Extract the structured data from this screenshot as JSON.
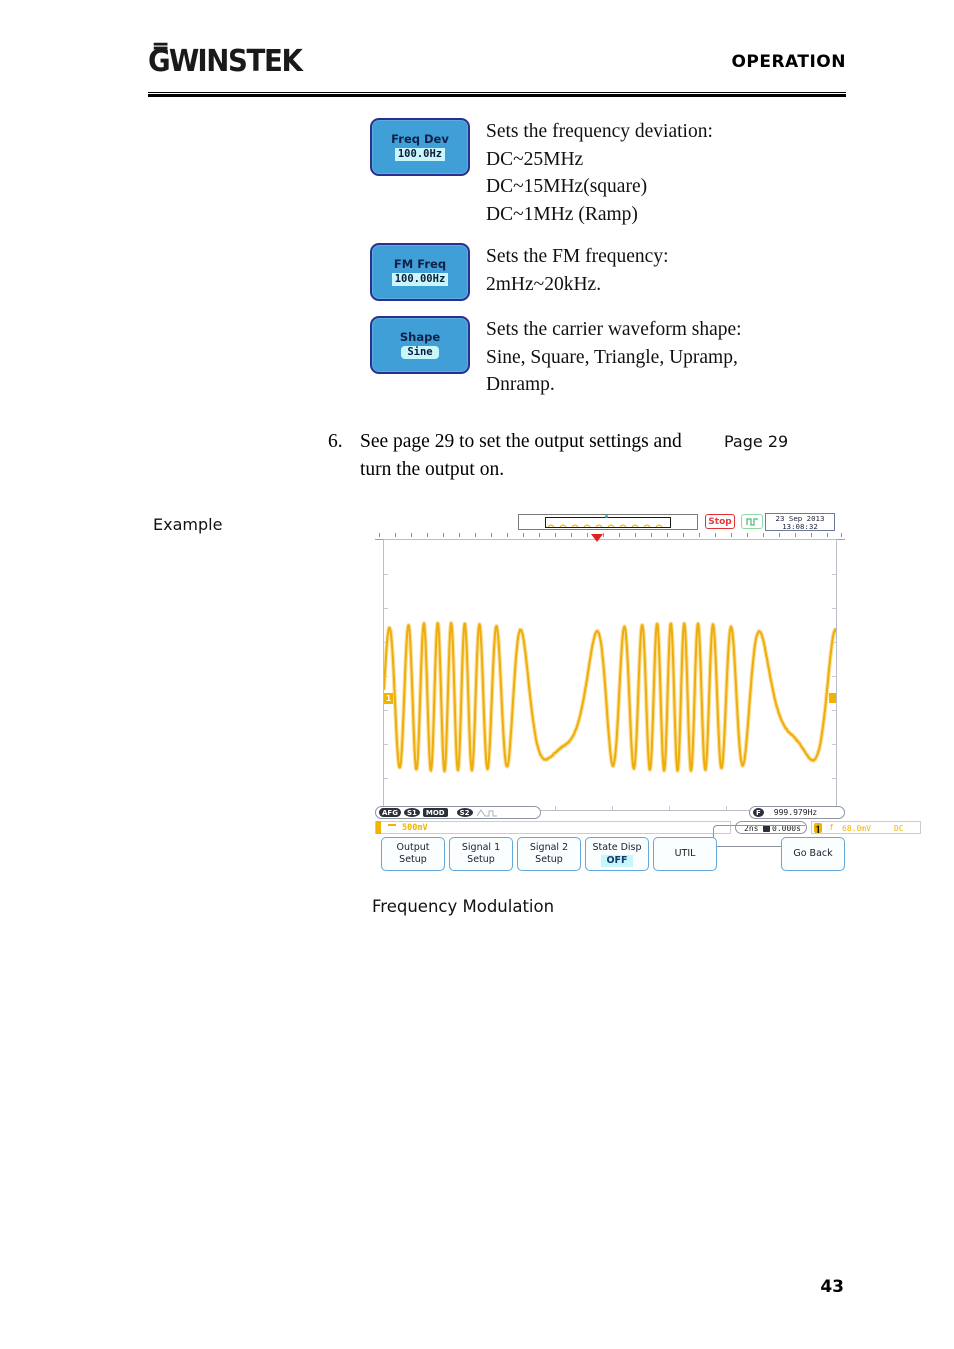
{
  "header": {
    "logo_gw": "G̿W",
    "logo_instek": "INSTEK",
    "title": "OPERATION"
  },
  "parameters": [
    {
      "key_label": "Freq Dev",
      "key_value": "100.0Hz",
      "description": "Sets the frequency deviation:\nDC~25MHz\nDC~15MHz(square)\nDC~1MHz (Ramp)"
    },
    {
      "key_label": "FM Freq",
      "key_value": "100.00Hz",
      "description": "Sets the FM frequency:\n2mHz~20kHz."
    },
    {
      "key_label": "Shape",
      "key_value": "Sine",
      "description": "Sets the carrier waveform shape:\nSine, Square, Triangle, Upramp,\nDnramp."
    }
  ],
  "step": {
    "number": "6.",
    "text": "See page 29 to set the output settings and turn the output on.",
    "xref": "Page 29"
  },
  "example": {
    "label": "Example",
    "caption": "Frequency Modulation"
  },
  "scope": {
    "status": "Stop",
    "date": "23 Sep 2013",
    "time": "13:08:32",
    "badges": [
      "AFG",
      "S1",
      "MOD",
      "S2"
    ],
    "frequency": "999.979Hz",
    "frequency_badge": "F",
    "channel1": {
      "label": "1",
      "volts_div": "500mV"
    },
    "timebase": "2ns",
    "horizontal_offset": "0.000s",
    "trigger": {
      "source": "1",
      "slope": "f",
      "level": "68.0mV",
      "coupling": "DC"
    },
    "softkeys": [
      {
        "line1": "Output",
        "line2": "Setup",
        "value": ""
      },
      {
        "line1": "Signal 1",
        "line2": "Setup",
        "value": ""
      },
      {
        "line1": "Signal 2",
        "line2": "Setup",
        "value": ""
      },
      {
        "line1": "State Disp",
        "line2": "",
        "value": "OFF"
      },
      {
        "line1": "UTIL",
        "line2": "",
        "value": ""
      },
      {
        "line1": "Go Back",
        "line2": "",
        "value": ""
      }
    ],
    "colors": {
      "waveform": "#eead0e",
      "channel": "#f0b400",
      "stop": "#e23b3b",
      "trigger_marker": "#e32020",
      "key_face": "#3e9ed5",
      "key_border": "#2b2f8f",
      "value_highlight": "#c9f6fb"
    }
  },
  "page_number": "43"
}
